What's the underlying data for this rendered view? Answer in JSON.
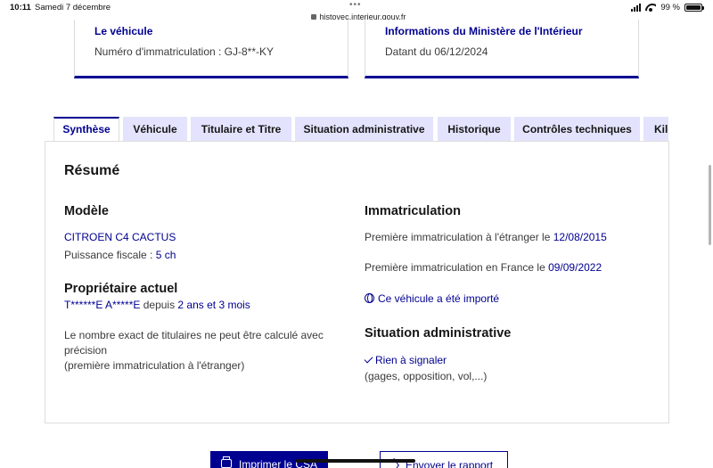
{
  "status_bar": {
    "time": "10:11",
    "date": "Samedi 7 décembre",
    "url": "histovec.interieur.gouv.fr",
    "battery": "99 %",
    "battery_level": 0.99
  },
  "cards": {
    "vehicle": {
      "title": "Le véhicule",
      "text": "Numéro d'immatriculation : GJ-8**-KY"
    },
    "ministry": {
      "title": "Informations du Ministère de l'Intérieur",
      "text": "Datant du 06/12/2024"
    }
  },
  "tabs": [
    {
      "label": "Synthèse",
      "active": true
    },
    {
      "label": "Véhicule",
      "active": false
    },
    {
      "label": "Titulaire et Titre",
      "active": false
    },
    {
      "label": "Situation administrative",
      "active": false
    },
    {
      "label": "Historique",
      "active": false
    },
    {
      "label": "Contrôles techniques",
      "active": false
    },
    {
      "label": "Kilométrage",
      "active": false
    }
  ],
  "summary": {
    "heading": "Résumé",
    "model": {
      "heading": "Modèle",
      "name": "CITROEN C4 CACTUS",
      "power_label": "Puissance fiscale : ",
      "power_value": "5 ch"
    },
    "owner": {
      "heading": "Propriétaire actuel",
      "name": "T******E A*****E",
      "since_label": " depuis ",
      "since_value": "2 ans et 3 mois",
      "note_line1": "Le nombre exact de titulaires ne peut être calculé avec",
      "note_line2": "précision",
      "note_line3": "(première immatriculation à l'étranger)"
    },
    "registration": {
      "heading": "Immatriculation",
      "foreign_label": "Première immatriculation à l'étranger le ",
      "foreign_date": "12/08/2015",
      "france_label": "Première immatriculation en France le ",
      "france_date": "09/09/2022",
      "imported_link": "Ce véhicule a été importé"
    },
    "admin": {
      "heading": "Situation administrative",
      "status": "Rien à signaler",
      "detail": "(gages, opposition, vol,...)"
    }
  },
  "buttons": {
    "print": "Imprimer le CSA",
    "send": "Envoyer le rapport"
  }
}
